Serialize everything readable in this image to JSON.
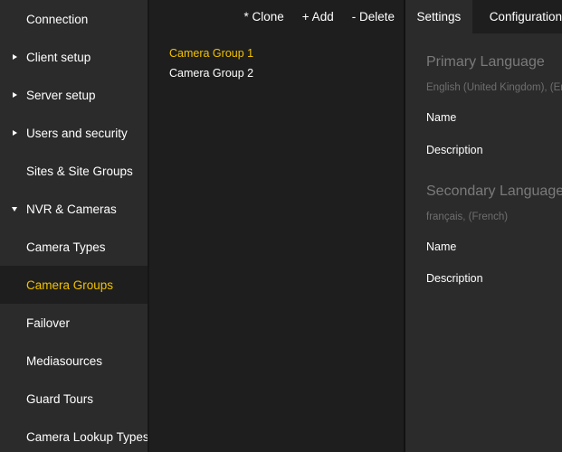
{
  "sidebar": {
    "items": [
      {
        "label": "Connection"
      },
      {
        "label": "Client setup"
      },
      {
        "label": "Server setup"
      },
      {
        "label": "Users and security"
      },
      {
        "label": "Sites & Site Groups"
      },
      {
        "label": "NVR & Cameras"
      },
      {
        "label": "Camera Types"
      },
      {
        "label": "Camera Groups"
      },
      {
        "label": "Failover"
      },
      {
        "label": "Mediasources"
      },
      {
        "label": "Guard Tours"
      },
      {
        "label": "Camera Lookup Types"
      }
    ]
  },
  "toolbar": {
    "clone_label": "* Clone",
    "add_label": "+ Add",
    "delete_label": "- Delete"
  },
  "groups": {
    "items": [
      {
        "label": "Camera Group 1"
      },
      {
        "label": "Camera Group 2"
      }
    ]
  },
  "tabs": {
    "settings_label": "Settings",
    "configuration_label": "Configuration"
  },
  "primary": {
    "title": "Primary Language",
    "language": "English (United Kingdom), (English)",
    "name_label": "Name",
    "description_label": "Description"
  },
  "secondary": {
    "title": "Secondary Language",
    "language": "français, (French)",
    "name_label": "Name",
    "description_label": "Description"
  },
  "colors": {
    "accent": "#f2c100",
    "sidebar_bg": "#2b2b2b",
    "panel_bg": "#1e1e1e"
  }
}
